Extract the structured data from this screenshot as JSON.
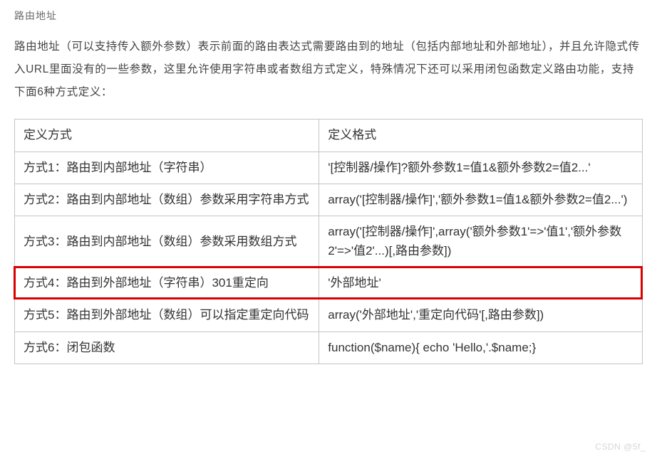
{
  "section_title": "路由地址",
  "description": "路由地址（可以支持传入额外参数）表示前面的路由表达式需要路由到的地址（包括内部地址和外部地址），并且允许隐式传入URL里面没有的一些参数，这里允许使用字符串或者数组方式定义，特殊情况下还可以采用闭包函数定义路由功能，支持下面6种方式定义：",
  "table": {
    "headers": [
      "定义方式",
      "定义格式"
    ],
    "rows": [
      {
        "method": "方式1：路由到内部地址（字符串）",
        "format": "'[控制器/操作]?额外参数1=值1&额外参数2=值2...'"
      },
      {
        "method": "方式2：路由到内部地址（数组）参数采用字符串方式",
        "format": "array('[控制器/操作]','额外参数1=值1&额外参数2=值2...')"
      },
      {
        "method": "方式3：路由到内部地址（数组）参数采用数组方式",
        "format": "array('[控制器/操作]',array('额外参数1'=>'值1','额外参数2'=>'值2'...)[,路由参数])"
      },
      {
        "method": "方式4：路由到外部地址（字符串）301重定向",
        "format": "'外部地址'",
        "highlighted": true
      },
      {
        "method": "方式5：路由到外部地址（数组）可以指定重定向代码",
        "format": "array('外部地址','重定向代码'[,路由参数])"
      },
      {
        "method": "方式6：闭包函数",
        "format": "function($name){ echo 'Hello,'.$name;}"
      }
    ]
  },
  "watermark": "CSDN @5f_"
}
